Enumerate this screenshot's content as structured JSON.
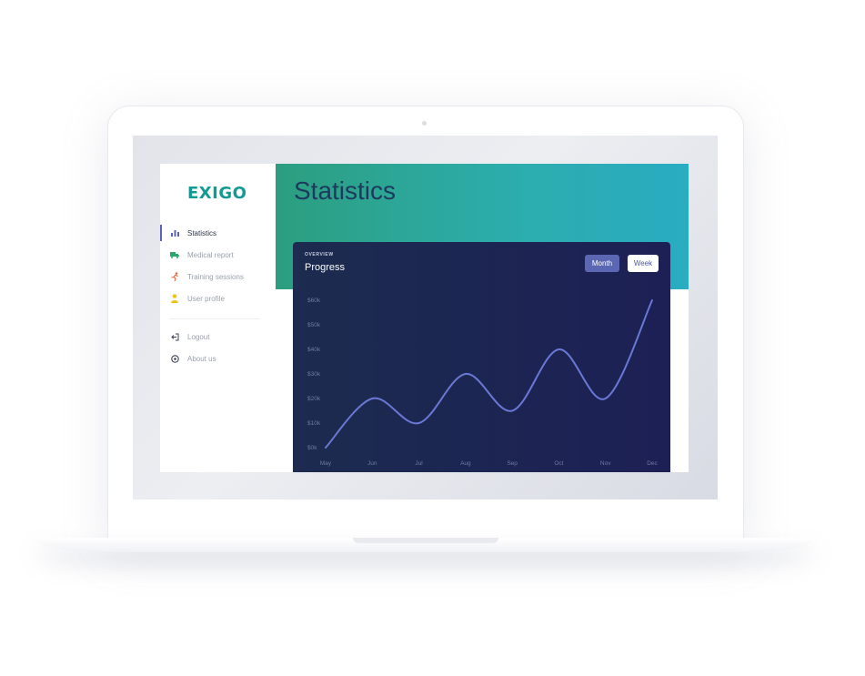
{
  "sidebar": {
    "logo": "EXIGO",
    "items": [
      {
        "label": "Statistics",
        "icon": "bar-chart-icon",
        "active": true
      },
      {
        "label": "Medical report",
        "icon": "ambulance-icon",
        "active": false
      },
      {
        "label": "Training sessions",
        "icon": "running-icon",
        "active": false
      },
      {
        "label": "User profile",
        "icon": "user-icon",
        "active": false
      }
    ],
    "secondary_items": [
      {
        "label": "Logout",
        "icon": "logout-icon"
      },
      {
        "label": "About us",
        "icon": "info-icon"
      }
    ]
  },
  "main": {
    "title": "Statistics"
  },
  "card": {
    "overline": "OVERVIEW",
    "title": "Progress",
    "month_button": "Month",
    "week_button": "Week"
  },
  "colors": {
    "brand": "#139a94",
    "header_gradient_start": "#2c9e7f",
    "header_gradient_end": "#2aacc2",
    "card_bg": "#1d2055",
    "line": "#6a78d6",
    "active_button": "#5b67b3"
  },
  "chart_data": {
    "type": "line",
    "categories": [
      "May",
      "Jun",
      "Jul",
      "Aug",
      "Sep",
      "Oct",
      "Nov",
      "Dec"
    ],
    "y_ticks": [
      "$0k",
      "$10k",
      "$20k",
      "$30k",
      "$40k",
      "$50k",
      "$60k"
    ],
    "ylim": [
      0,
      60
    ],
    "grid": false,
    "series": [
      {
        "points": [
          {
            "x": "May",
            "y": 0
          },
          {
            "x": "Jun",
            "y": 20
          },
          {
            "x": "Jul",
            "y": 10
          },
          {
            "x": "Aug",
            "y": 30
          },
          {
            "x": "Sep",
            "y": 15
          },
          {
            "x": "Oct",
            "y": 40
          },
          {
            "x": "Nov",
            "y": 20
          },
          {
            "x": "Dec",
            "y": 60
          }
        ]
      }
    ]
  }
}
